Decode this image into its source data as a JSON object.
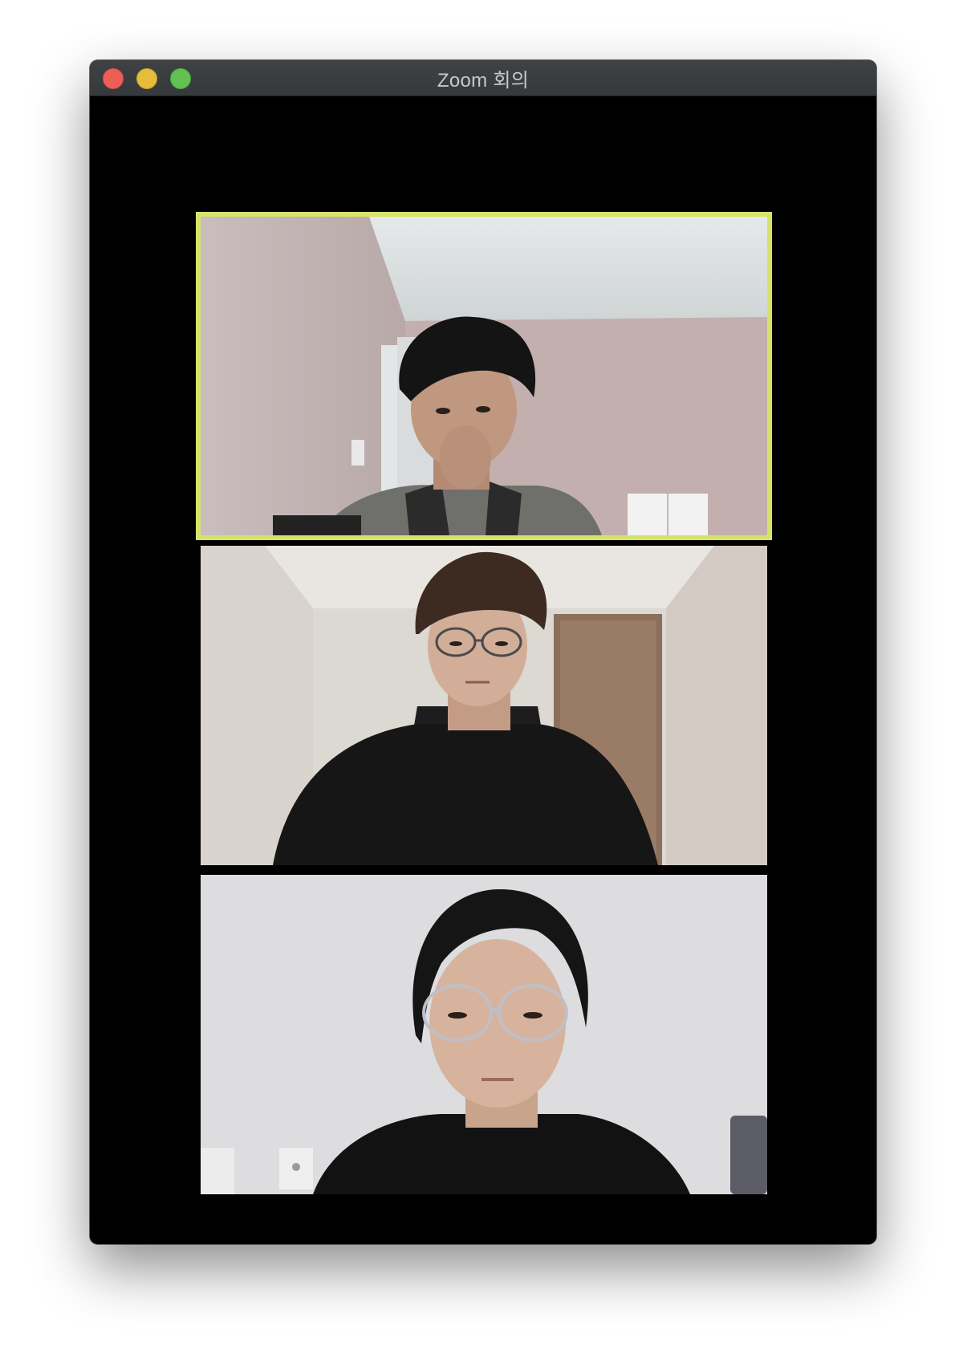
{
  "window": {
    "title": "Zoom 회의"
  },
  "controls": {
    "close": "close-icon",
    "minimize": "minimize-icon",
    "maximize": "maximize-icon"
  },
  "participants": [
    {
      "position": 1,
      "active_speaker": true
    },
    {
      "position": 2,
      "active_speaker": false
    },
    {
      "position": 3,
      "active_speaker": false
    }
  ],
  "colors": {
    "active_speaker_border": "#d6e26a",
    "window_background": "#000000",
    "titlebar": "#3a3d40",
    "close": "#ec5f57",
    "minimize": "#e5bc3b",
    "maximize": "#62c152"
  }
}
